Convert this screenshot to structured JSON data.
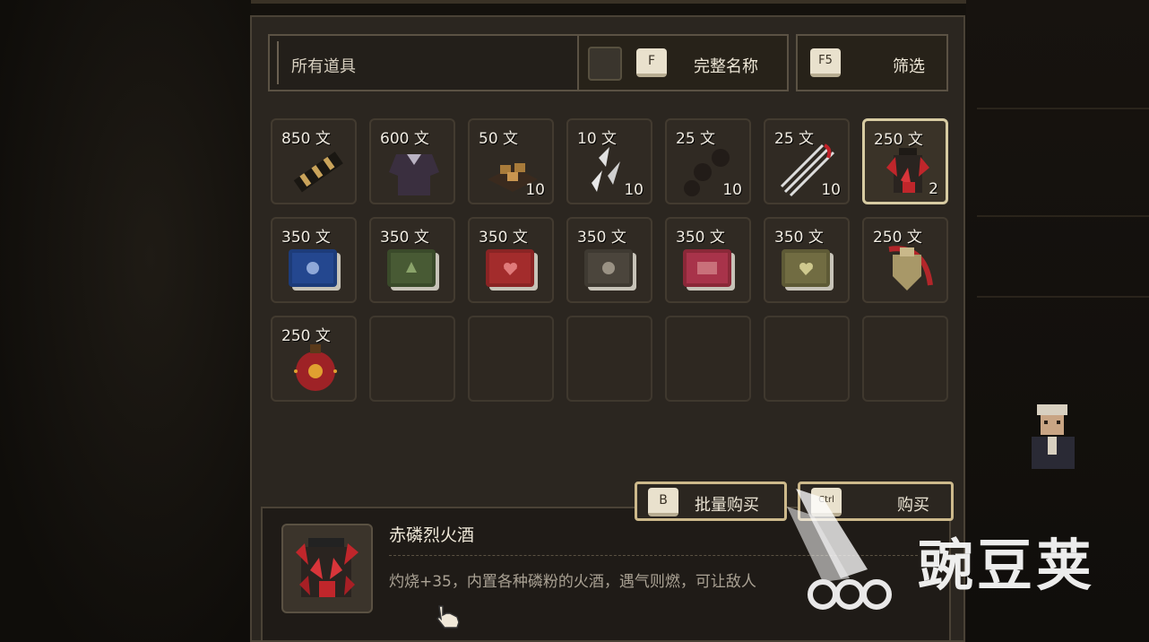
{
  "filter": {
    "category_label": "所有道具"
  },
  "toolbar": {
    "fullname_key": "F",
    "fullname_label": "完整名称",
    "filter_key": "F5",
    "filter_label": "筛选"
  },
  "items": [
    {
      "price": "850 文",
      "qty": "",
      "icon": "black-club-icon"
    },
    {
      "price": "600 文",
      "qty": "",
      "icon": "dark-armor-icon"
    },
    {
      "price": "50 文",
      "qty": "10",
      "icon": "food-tray-icon"
    },
    {
      "price": "10 文",
      "qty": "10",
      "icon": "throwing-knives-icon"
    },
    {
      "price": "25 文",
      "qty": "10",
      "icon": "iron-balls-icon"
    },
    {
      "price": "25 文",
      "qty": "10",
      "icon": "red-needles-icon"
    },
    {
      "price": "250 文",
      "qty": "2",
      "icon": "fire-wine-jar-icon"
    },
    {
      "price": "350 文",
      "qty": "",
      "icon": "blue-skull-manual-icon"
    },
    {
      "price": "350 文",
      "qty": "",
      "icon": "green-manual-icon"
    },
    {
      "price": "350 文",
      "qty": "",
      "icon": "red-heart-manual-icon"
    },
    {
      "price": "350 文",
      "qty": "",
      "icon": "gray-skull-manual-icon"
    },
    {
      "price": "350 文",
      "qty": "",
      "icon": "crimson-manual-icon"
    },
    {
      "price": "350 文",
      "qty": "",
      "icon": "khaki-heart-manual-icon"
    },
    {
      "price": "250 文",
      "qty": "",
      "icon": "shield-amulet-icon"
    },
    {
      "price": "250 文",
      "qty": "",
      "icon": "red-bomb-icon"
    }
  ],
  "empty_slots": 6,
  "actions": {
    "bulk_key": "B",
    "bulk_label": "批量购买",
    "buy_key": "Ctrl",
    "buy_label": "购买"
  },
  "detail": {
    "name": "赤磷烈火酒",
    "description": "灼烧+35，内置各种磷粉的火酒，遇气则燃，可让敌人"
  },
  "watermark": "豌豆荚",
  "colors": {
    "panel_bg": "#2b2620",
    "slot_border": "#433b30",
    "selected_border": "#d7cba2",
    "button_border": "#cdb98b",
    "text": "#efe8d8"
  }
}
